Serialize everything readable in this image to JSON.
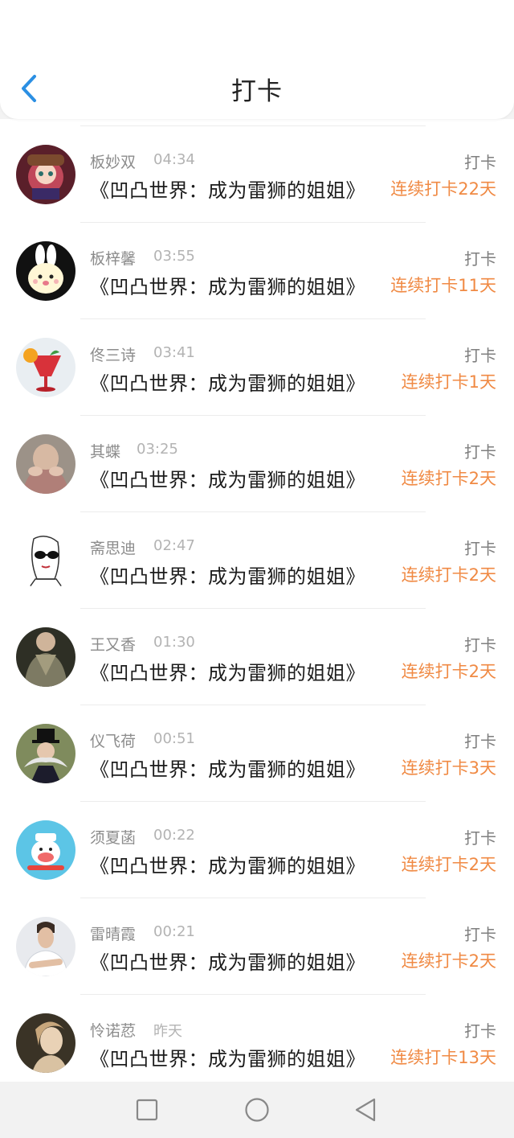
{
  "header": {
    "title": "打卡",
    "back_icon": "chevron-left-icon",
    "accent": "#2b8fe3"
  },
  "colors": {
    "streak": "#f08a44",
    "action": "#7f7f7f"
  },
  "checkins": [
    {
      "name": "板妙双",
      "time": "04:34",
      "book": "《凹凸世界：成为雷狮的姐姐》",
      "action": "打卡",
      "streak": "连续打卡22天",
      "avatar": "anime-girl-avatar"
    },
    {
      "name": "板梓馨",
      "time": "03:55",
      "book": "《凹凸世界：成为雷狮的姐姐》",
      "action": "打卡",
      "streak": "连续打卡11天",
      "avatar": "cartoon-bunny-avatar"
    },
    {
      "name": "佟三诗",
      "time": "03:41",
      "book": "《凹凸世界：成为雷狮的姐姐》",
      "action": "打卡",
      "streak": "连续打卡1天",
      "avatar": "cocktail-avatar"
    },
    {
      "name": "其蝶",
      "time": "03:25",
      "book": "《凹凸世界：成为雷狮的姐姐》",
      "action": "打卡",
      "streak": "连续打卡2天",
      "avatar": "girl-hands-avatar"
    },
    {
      "name": "斋思迪",
      "time": "02:47",
      "book": "《凹凸世界：成为雷狮的姐姐》",
      "action": "打卡",
      "streak": "连续打卡2天",
      "avatar": "sketch-sunglasses-avatar"
    },
    {
      "name": "王又香",
      "time": "01:30",
      "book": "《凹凸世界：成为雷狮的姐姐》",
      "action": "打卡",
      "streak": "连续打卡2天",
      "avatar": "woman-scarf-avatar"
    },
    {
      "name": "仪飞荷",
      "time": "00:51",
      "book": "《凹凸世界：成为雷狮的姐姐》",
      "action": "打卡",
      "streak": "连续打卡3天",
      "avatar": "top-hat-mustache-avatar"
    },
    {
      "name": "须夏菡",
      "time": "00:22",
      "book": "《凹凸世界：成为雷狮的姐姐》",
      "action": "打卡",
      "streak": "连续打卡2天",
      "avatar": "cartoon-monkey-avatar"
    },
    {
      "name": "雷晴霞",
      "time": "00:21",
      "book": "《凹凸世界：成为雷狮的姐姐》",
      "action": "打卡",
      "streak": "连续打卡2天",
      "avatar": "young-man-avatar"
    },
    {
      "name": "怜诺荵",
      "time": "昨天",
      "book": "《凹凸世界：成为雷狮的姐姐》",
      "action": "打卡",
      "streak": "连续打卡13天",
      "avatar": "woman-portrait-avatar"
    }
  ],
  "navbar": {
    "items": [
      "recents-icon",
      "home-icon",
      "back-triangle-icon"
    ]
  }
}
